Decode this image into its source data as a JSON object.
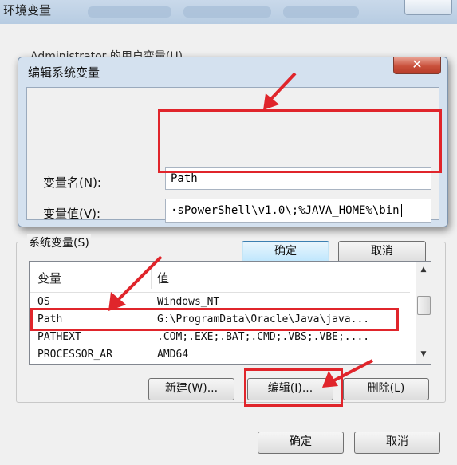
{
  "outer_window": {
    "title": "环境变量",
    "user_vars_title": "Administrator 的用户变量(U)"
  },
  "edit_dialog": {
    "title": "编辑系统变量",
    "close_glyph": "✕",
    "name_label": "变量名(N):",
    "name_value": "Path",
    "value_label": "变量值(V):",
    "value_value": "·sPowerShell\\v1.0\\;%JAVA_HOME%\\bin",
    "ok_label": "确定",
    "cancel_label": "取消"
  },
  "system_vars": {
    "group_title": "系统变量(S)",
    "columns": [
      "变量",
      "值"
    ],
    "rows": [
      {
        "name": "OS",
        "value": "Windows_NT"
      },
      {
        "name": "Path",
        "value": "G:\\ProgramData\\Oracle\\Java\\java..."
      },
      {
        "name": "PATHEXT",
        "value": ".COM;.EXE;.BAT;.CMD;.VBS;.VBE;...."
      },
      {
        "name": "PROCESSOR_AR",
        "value": "AMD64"
      }
    ],
    "new_label": "新建(W)...",
    "edit_label": "编辑(I)...",
    "delete_label": "删除(L)"
  },
  "footer": {
    "ok_label": "确定",
    "cancel_label": "取消"
  },
  "colors": {
    "annotation_red": "#e0252b",
    "dialog_frame": "#d4e1ef",
    "window_bg": "#f0f0f0"
  }
}
